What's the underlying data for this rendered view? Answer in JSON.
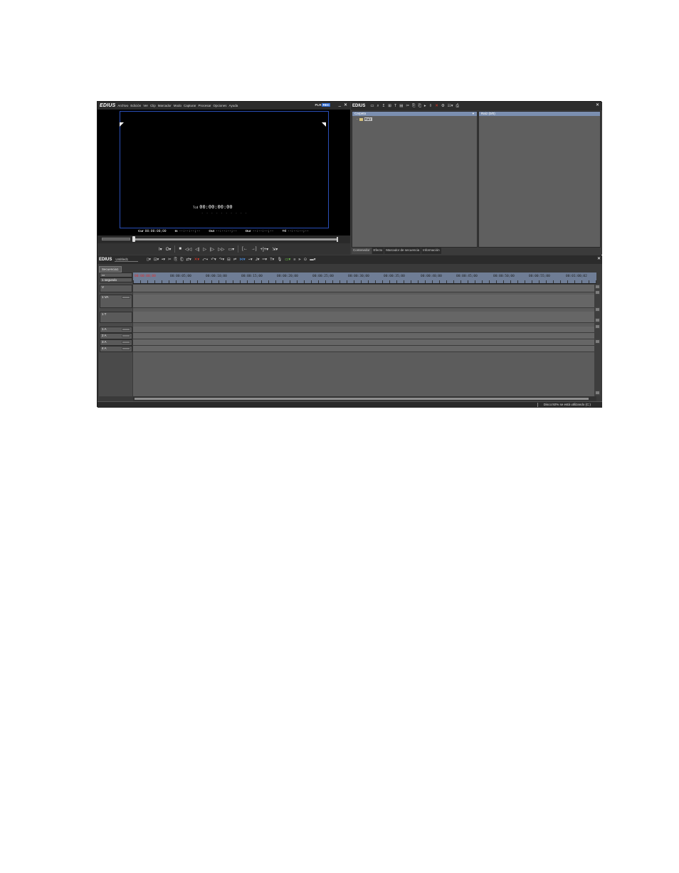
{
  "preview": {
    "logo": "EDIUS",
    "menu": [
      "Archivo",
      "Edición",
      "Ver",
      "Clip",
      "Marcador",
      "Modo",
      "Capturar",
      "Procesar",
      "Opciones",
      "Ayuda"
    ],
    "plr": "PLR",
    "rec": "REC",
    "timecode_label": "Tcd",
    "timecode": "00:00:00:00",
    "timecode_dots": "- - - - - - - - - -",
    "cur_label": "Cur",
    "cur_value": "00:00:00;00",
    "in_label": "In",
    "in_value": "--:--:--;--",
    "out_label": "Out",
    "out_value": "--:--:--;--",
    "dur_label": "Dur",
    "dur_value": "--:--:--;--",
    "ttl_label": "Ttl",
    "ttl_value": "--:--:--;--"
  },
  "bin": {
    "logo": "EDIUS",
    "folder_header": "Carpeta",
    "root_folder": "Raíz",
    "clip_header": "Raíz (0/0)",
    "tabs": [
      "Contenedor",
      "Efecto",
      "Marcador de secuencia",
      "Información"
    ]
  },
  "timeline": {
    "logo": "EDIUS",
    "sequence_name": "Untitled1",
    "sequence_tab": "Secuencia1",
    "zoom_label": "1 segundo",
    "ruler": [
      "00:00:00;00",
      "00:00:05;00",
      "00:00:10;00",
      "00:00:15;00",
      "00:00:20;00",
      "00:00:25;00",
      "00:00:30;00",
      "00:00:35;00",
      "00:00:40;00",
      "00:00:45;00",
      "00:00:50;00",
      "00:00:55;00",
      "00:01:00;02"
    ],
    "tracks": {
      "v": "V",
      "va": "1 VA",
      "t": "1 T",
      "a1": "1 A",
      "a2": "2 A",
      "a3": "3 A",
      "a4": "4 A"
    },
    "status": "Disco:92% se está utilizando (C:)"
  }
}
